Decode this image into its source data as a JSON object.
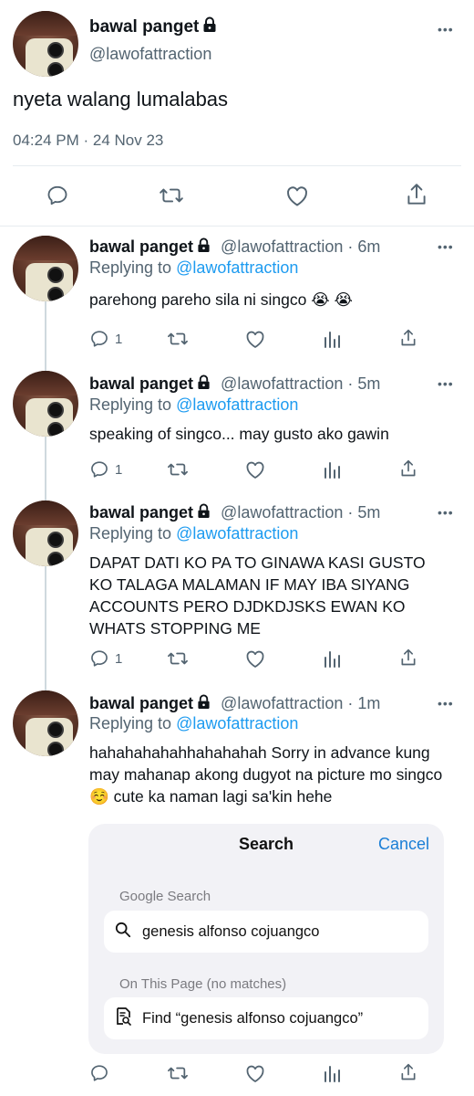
{
  "main_tweet": {
    "display_name": "bawal panget",
    "handle": "@lawofattraction",
    "text": "nyeta walang lumalabas",
    "timestamp": "04:24 PM · 24 Nov 23",
    "more_label": "•••"
  },
  "replies": [
    {
      "display_name": "bawal panget",
      "handle": "@lawofattraction",
      "time": "· 6m",
      "replying_prefix": "Replying to",
      "replying_to": "@lawofattraction",
      "text": "parehong pareho sila ni singco 😭 😭",
      "reply_count": "1",
      "more_label": "•••"
    },
    {
      "display_name": "bawal panget",
      "handle": "@lawofattraction",
      "time": "· 5m",
      "replying_prefix": "Replying to",
      "replying_to": "@lawofattraction",
      "text": "speaking of singco... may gusto ako gawin",
      "reply_count": "1",
      "more_label": "•••"
    },
    {
      "display_name": "bawal panget",
      "handle": "@lawofattraction",
      "time": "· 5m",
      "replying_prefix": "Replying to",
      "replying_to": "@lawofattraction",
      "text": "DAPAT DATI KO PA TO GINAWA KASI GUSTO KO TALAGA MALAMAN IF MAY IBA SIYANG ACCOUNTS PERO DJDKDJSKS EWAN KO WHATS STOPPING ME",
      "reply_count": "1",
      "more_label": "•••"
    },
    {
      "display_name": "bawal panget",
      "handle": "@lawofattraction",
      "time": "· 1m",
      "replying_prefix": "Replying to",
      "replying_to": "@lawofattraction",
      "text": "hahahahahahhahahahah Sorry in advance kung may mahanap akong dugyot na picture mo singco ☺️ cute ka naman lagi sa'kin hehe",
      "reply_count": "",
      "more_label": "•••"
    }
  ],
  "search_sheet": {
    "title": "Search",
    "cancel_label": "Cancel",
    "google_section": "Google Search",
    "google_query": "genesis alfonso cojuangco",
    "page_section": "On This Page (no matches)",
    "find_label": "Find “genesis alfonso cojuangco”"
  },
  "colors": {
    "text_primary": "#0f1419",
    "text_secondary": "#536471",
    "link": "#1d9bf0",
    "divider": "#e6ecf0",
    "sheet_bg": "#f2f2f6",
    "cancel": "#1a7ed6"
  },
  "icons": [
    "lock-icon",
    "reply-icon",
    "retweet-icon",
    "like-icon",
    "share-icon",
    "views-icon",
    "more-icon",
    "search-icon",
    "find-in-page-icon"
  ]
}
